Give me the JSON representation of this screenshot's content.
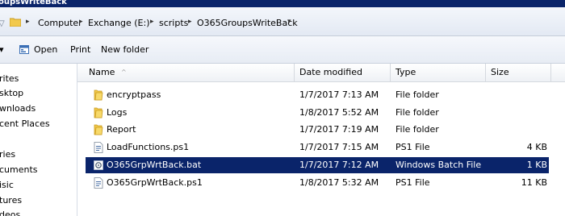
{
  "window": {
    "title": "oupsWriteBack"
  },
  "address": {
    "crumbs": [
      "Computer",
      "Exchange (E:)",
      "scripts",
      "O365GroupsWriteBack"
    ]
  },
  "toolbar": {
    "organize_label": "",
    "open_label": "Open",
    "print_label": "Print",
    "new_folder_label": "New folder"
  },
  "nav": {
    "items": [
      "rites",
      "sktop",
      "wnloads",
      "cent Places",
      "ries",
      "cuments",
      "isic",
      "tures",
      "deos"
    ]
  },
  "columns": {
    "name": "Name",
    "date": "Date modified",
    "type": "Type",
    "size": "Size"
  },
  "files": [
    {
      "name": "encryptpass",
      "date": "1/7/2017 7:13 AM",
      "type": "File folder",
      "size": "",
      "icon": "folder-icon"
    },
    {
      "name": "Logs",
      "date": "1/8/2017 5:52 AM",
      "type": "File folder",
      "size": "",
      "icon": "folder-icon"
    },
    {
      "name": "Report",
      "date": "1/7/2017 7:19 AM",
      "type": "File folder",
      "size": "",
      "icon": "folder-icon"
    },
    {
      "name": "LoadFunctions.ps1",
      "date": "1/7/2017 7:15 AM",
      "type": "PS1 File",
      "size": "4 KB",
      "icon": "script-file-icon"
    },
    {
      "name": "O365GrpWrtBack.bat",
      "date": "1/7/2017 7:12 AM",
      "type": "Windows Batch File",
      "size": "1 KB",
      "icon": "batch-file-icon",
      "selected": true
    },
    {
      "name": "O365GrpWrtBack.ps1",
      "date": "1/8/2017 5:32 AM",
      "type": "PS1 File",
      "size": "11 KB",
      "icon": "script-file-icon"
    }
  ],
  "colors": {
    "selection": "#0a246a",
    "titlebar": "#0a246a"
  }
}
